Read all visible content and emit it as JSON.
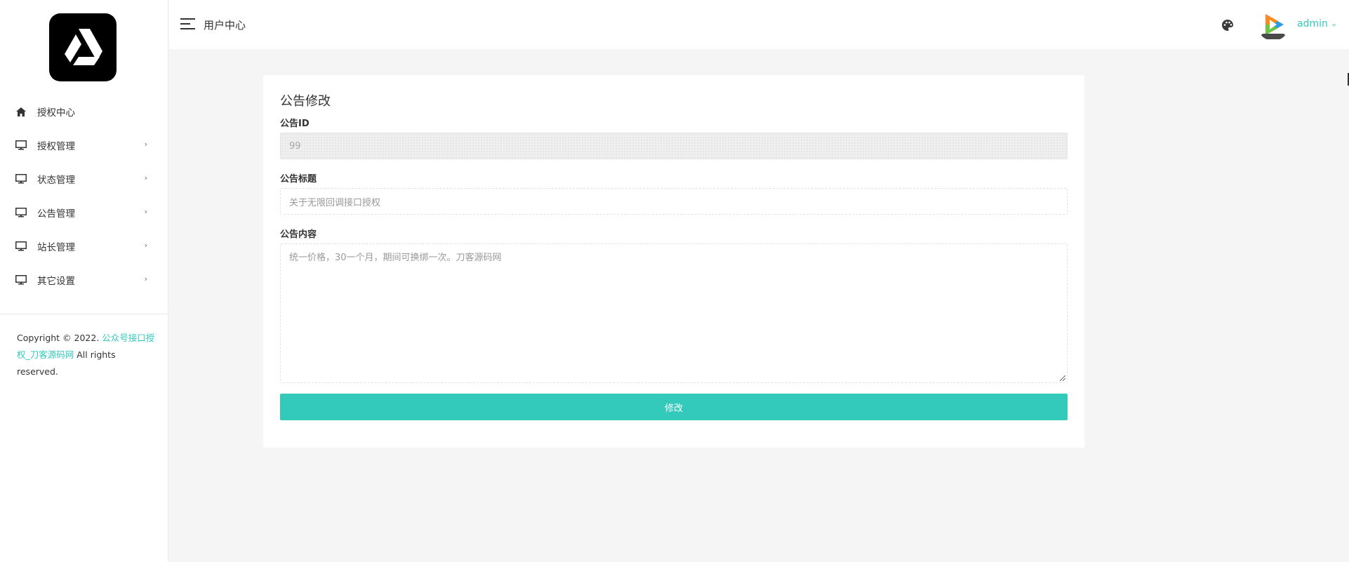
{
  "sidebar": {
    "logo_icon": "google-drive-style-triangle-logo",
    "items": [
      {
        "label": "授权中心",
        "icon": "home-icon",
        "has_arrow": false
      },
      {
        "label": "授权管理",
        "icon": "monitor-icon",
        "has_arrow": true
      },
      {
        "label": "状态管理",
        "icon": "monitor-icon",
        "has_arrow": true
      },
      {
        "label": "公告管理",
        "icon": "monitor-icon",
        "has_arrow": true
      },
      {
        "label": "站长管理",
        "icon": "monitor-icon",
        "has_arrow": true
      },
      {
        "label": "其它设置",
        "icon": "monitor-icon",
        "has_arrow": true
      }
    ],
    "arrow_glyph": "›",
    "copyright": {
      "prefix": "Copyright © 2022. ",
      "link_text": "公众号接口授权_刀客源码网",
      "suffix": " All rights reserved."
    }
  },
  "topbar": {
    "title": "用户中心",
    "username": "admin",
    "chevron": "⌄",
    "palette_icon": "palette-icon",
    "avatar_icon": "video-play-logo-avatar"
  },
  "form": {
    "title": "公告修改",
    "id_label": "公告ID",
    "id_value": "99",
    "title_label": "公告标题",
    "title_placeholder": "关于无限回调接口授权",
    "content_label": "公告内容",
    "content_placeholder": "统一价格，30一个月，期间可换绑一次。刀客源码网",
    "submit_label": "修改"
  },
  "colors": {
    "accent": "#33cabb",
    "background": "#f4f5f4",
    "sidebar_bg": "#ffffff"
  }
}
